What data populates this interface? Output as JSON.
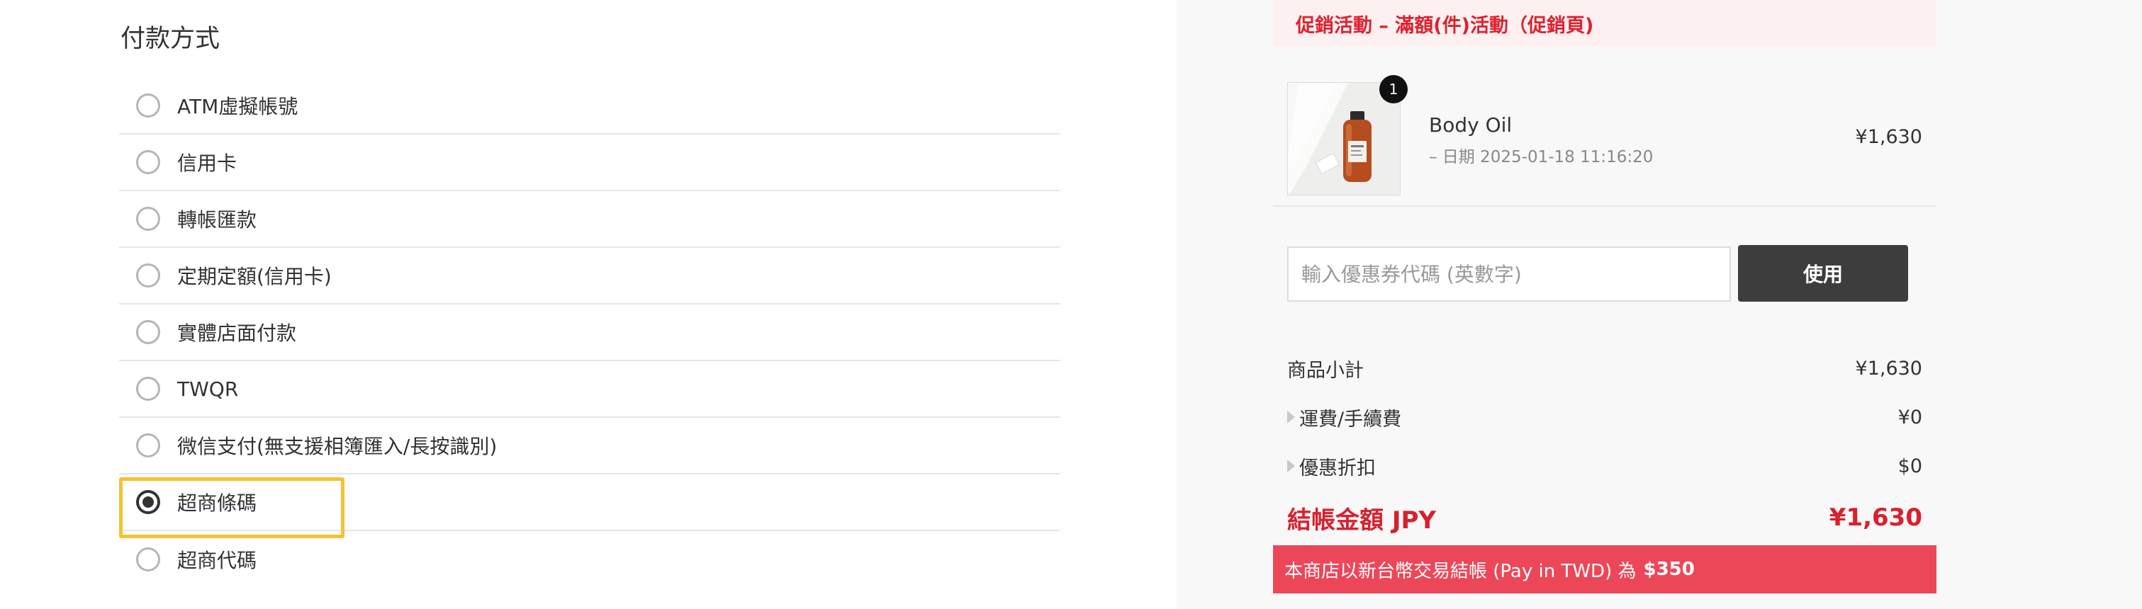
{
  "payment": {
    "title": "付款方式",
    "options": [
      {
        "label": "ATM虛擬帳號",
        "selected": false
      },
      {
        "label": "信用卡",
        "selected": false
      },
      {
        "label": "轉帳匯款",
        "selected": false
      },
      {
        "label": "定期定額(信用卡)",
        "selected": false
      },
      {
        "label": "實體店面付款",
        "selected": false
      },
      {
        "label": "TWQR",
        "selected": false
      },
      {
        "label": "微信支付(無支援相簿匯入/長按識別)",
        "selected": false
      },
      {
        "label": "超商條碼",
        "selected": true
      },
      {
        "label": "超商代碼",
        "selected": false
      }
    ]
  },
  "order": {
    "promo": "促銷活動 – 滿額(件)活動（促銷頁)",
    "item": {
      "quantity": "1",
      "name": "Body Oil",
      "meta": "– 日期 2025-01-18 11:16:20",
      "price": "¥1,630"
    },
    "coupon": {
      "placeholder": "輸入優惠券代碼 (英數字)",
      "button": "使用"
    },
    "summary": {
      "subtotal_label": "商品小計",
      "subtotal_value": "¥1,630",
      "shipping_label": "運費/手續費",
      "shipping_value": "¥0",
      "discount_label": "優惠折扣",
      "discount_value": "$0",
      "total_label": "結帳金額 JPY",
      "total_value": "¥1,630"
    },
    "twd_notice": "本商店以新台幣交易結帳 (Pay in TWD) 為",
    "twd_amount": "$350"
  },
  "colors": {
    "accent_red": "#d9202e",
    "banner_red": "#ec4758",
    "highlight": "#f5c230"
  }
}
